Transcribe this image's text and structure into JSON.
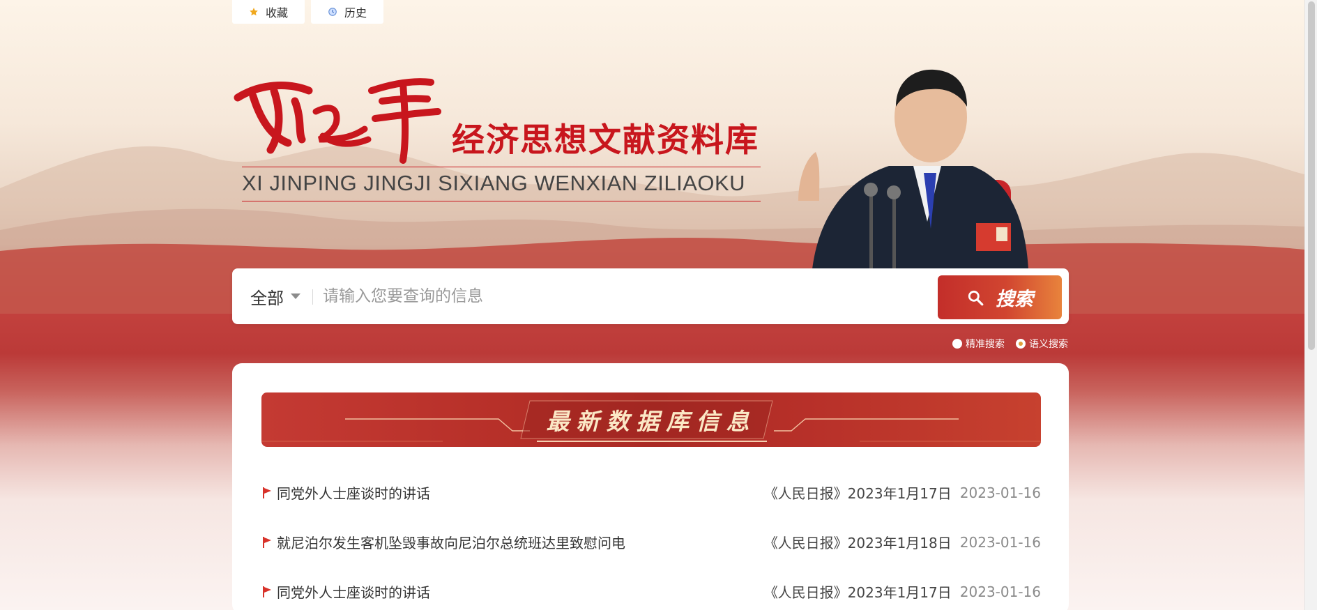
{
  "top_tabs": {
    "favorites": {
      "label": "收藏",
      "icon": "star-icon"
    },
    "history": {
      "label": "历史",
      "icon": "clock-icon"
    }
  },
  "header": {
    "calligraphy": "习近平",
    "title_cn": "经济思想文献资料库",
    "title_en": "XI JINPING JINGJI SIXIANG WENXIAN ZILIAOKU"
  },
  "search": {
    "scope": "全部",
    "placeholder": "请输入您要查询的信息",
    "button_label": "搜索",
    "modes": [
      {
        "label": "精准搜索",
        "checked": false
      },
      {
        "label": "语义搜索",
        "checked": true
      }
    ]
  },
  "latest": {
    "banner_title": "最新数据库信息",
    "items": [
      {
        "title": "同党外人士座谈时的讲话",
        "source": "《人民日报》2023年1月17日",
        "date": "2023-01-16"
      },
      {
        "title": "就尼泊尔发生客机坠毁事故向尼泊尔总统班达里致慰问电",
        "source": "《人民日报》2023年1月18日",
        "date": "2023-01-16"
      },
      {
        "title": "同党外人士座谈时的讲话",
        "source": "《人民日报》2023年1月17日",
        "date": "2023-01-16"
      }
    ]
  },
  "colors": {
    "brand_red": "#c8161d",
    "button_start": "#c32e2a",
    "button_end": "#e8833c",
    "banner_text": "#fbe8c6"
  }
}
